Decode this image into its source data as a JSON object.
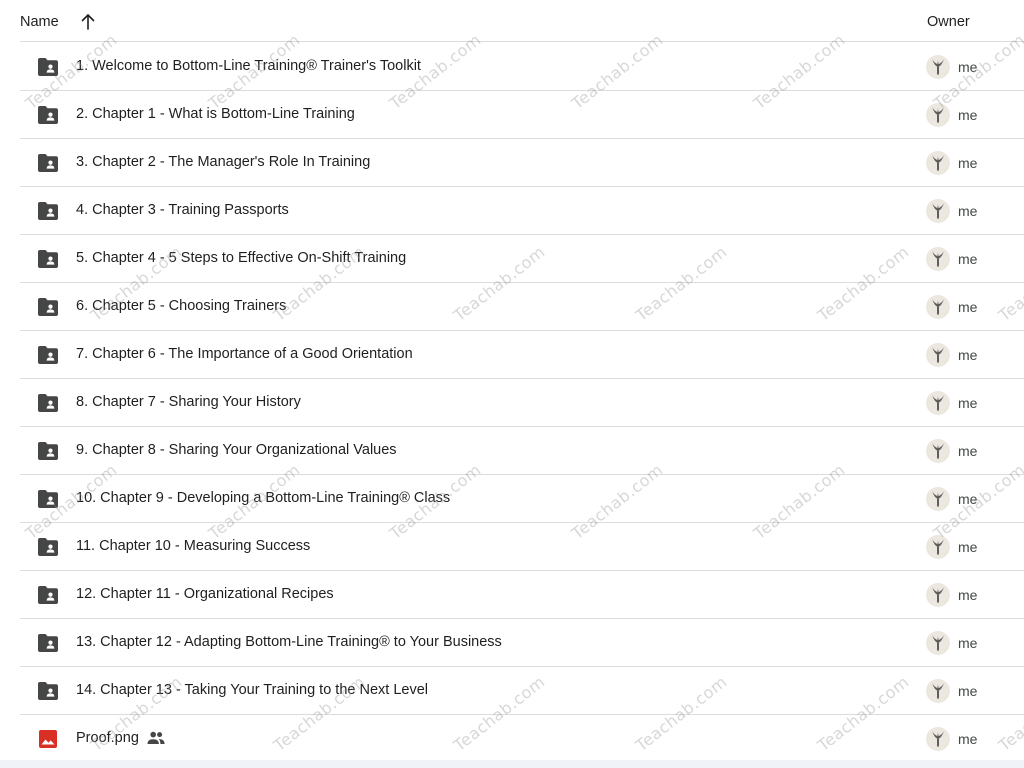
{
  "header": {
    "name_label": "Name",
    "sort_icon": "arrow-upward-icon",
    "owner_label": "Owner"
  },
  "files": [
    {
      "name": "1. Welcome to Bottom-Line Training® Trainer's Toolkit",
      "type": "folder",
      "icon": "folder-shared-icon",
      "owner": "me"
    },
    {
      "name": "2. Chapter 1 - What is Bottom-Line Training",
      "type": "folder",
      "icon": "folder-shared-icon",
      "owner": "me"
    },
    {
      "name": "3. Chapter 2 - The Manager's Role In Training",
      "type": "folder",
      "icon": "folder-shared-icon",
      "owner": "me"
    },
    {
      "name": "4. Chapter 3 - Training Passports",
      "type": "folder",
      "icon": "folder-shared-icon",
      "owner": "me"
    },
    {
      "name": "5. Chapter 4 - 5 Steps to Effective On-Shift Training",
      "type": "folder",
      "icon": "folder-shared-icon",
      "owner": "me"
    },
    {
      "name": "6. Chapter 5 - Choosing Trainers",
      "type": "folder",
      "icon": "folder-shared-icon",
      "owner": "me"
    },
    {
      "name": "7. Chapter 6 - The Importance of a Good Orientation",
      "type": "folder",
      "icon": "folder-shared-icon",
      "owner": "me"
    },
    {
      "name": "8. Chapter 7 - Sharing Your History",
      "type": "folder",
      "icon": "folder-shared-icon",
      "owner": "me"
    },
    {
      "name": "9. Chapter 8 - Sharing Your Organizational Values",
      "type": "folder",
      "icon": "folder-shared-icon",
      "owner": "me"
    },
    {
      "name": "10. Chapter 9 - Developing a Bottom-Line Training® Class",
      "type": "folder",
      "icon": "folder-shared-icon",
      "owner": "me"
    },
    {
      "name": "11. Chapter 10 - Measuring Success",
      "type": "folder",
      "icon": "folder-shared-icon",
      "owner": "me"
    },
    {
      "name": "12. Chapter 11 - Organizational Recipes",
      "type": "folder",
      "icon": "folder-shared-icon",
      "owner": "me"
    },
    {
      "name": "13. Chapter 12 - Adapting Bottom-Line Training® to Your Business",
      "type": "folder",
      "icon": "folder-shared-icon",
      "owner": "me"
    },
    {
      "name": "14. Chapter 13 - Taking Your Training to the Next Level",
      "type": "folder",
      "icon": "folder-shared-icon",
      "owner": "me"
    },
    {
      "name": "Proof.png",
      "type": "image",
      "icon": "image-file-icon",
      "shared": true,
      "shared_icon": "people-icon",
      "owner": "me"
    }
  ],
  "watermark_text": "Teachab.com",
  "colors": {
    "folder_icon": "#444746",
    "image_icon": "#d93025",
    "divider": "#dadce0",
    "avatar_bg": "#ece7df"
  }
}
